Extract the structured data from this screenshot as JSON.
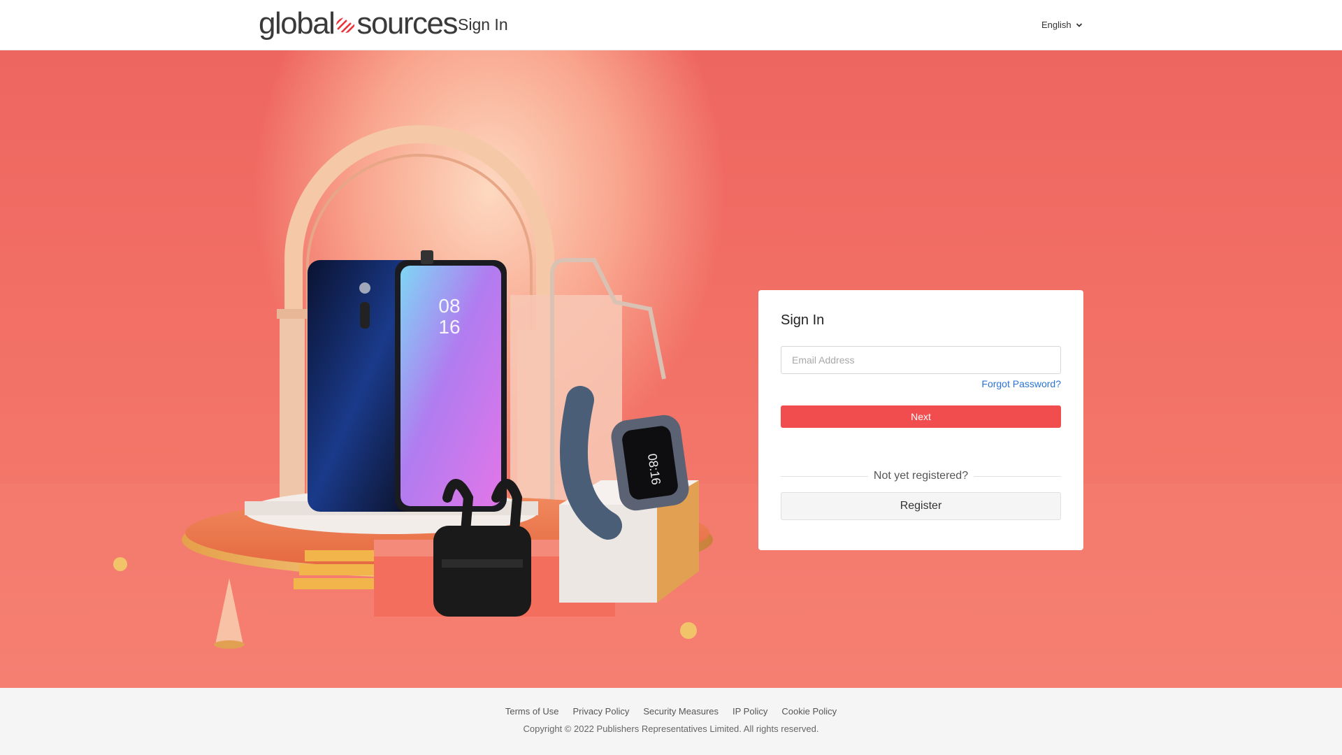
{
  "header": {
    "logo_left": "global",
    "logo_right": "sources",
    "page_title": "Sign In",
    "language": "English"
  },
  "signin": {
    "title": "Sign In",
    "email_placeholder": "Email Address",
    "email_value": "",
    "forgot_password": "Forgot Password?",
    "next_label": "Next",
    "not_registered": "Not yet registered?",
    "register_label": "Register"
  },
  "footer": {
    "links": [
      "Terms of Use",
      "Privacy Policy",
      "Security Measures",
      "IP Policy",
      "Cookie Policy"
    ],
    "copyright": "Copyright © 2022 Publishers Representatives Limited. All rights reserved."
  },
  "colors": {
    "brand_red": "#f14d4f",
    "link_blue": "#2a74d4",
    "hero_bg": "#ee6660"
  },
  "icons": {
    "language_chevron": "chevron-down-icon",
    "logo_mark": "globe-stripes-icon"
  }
}
